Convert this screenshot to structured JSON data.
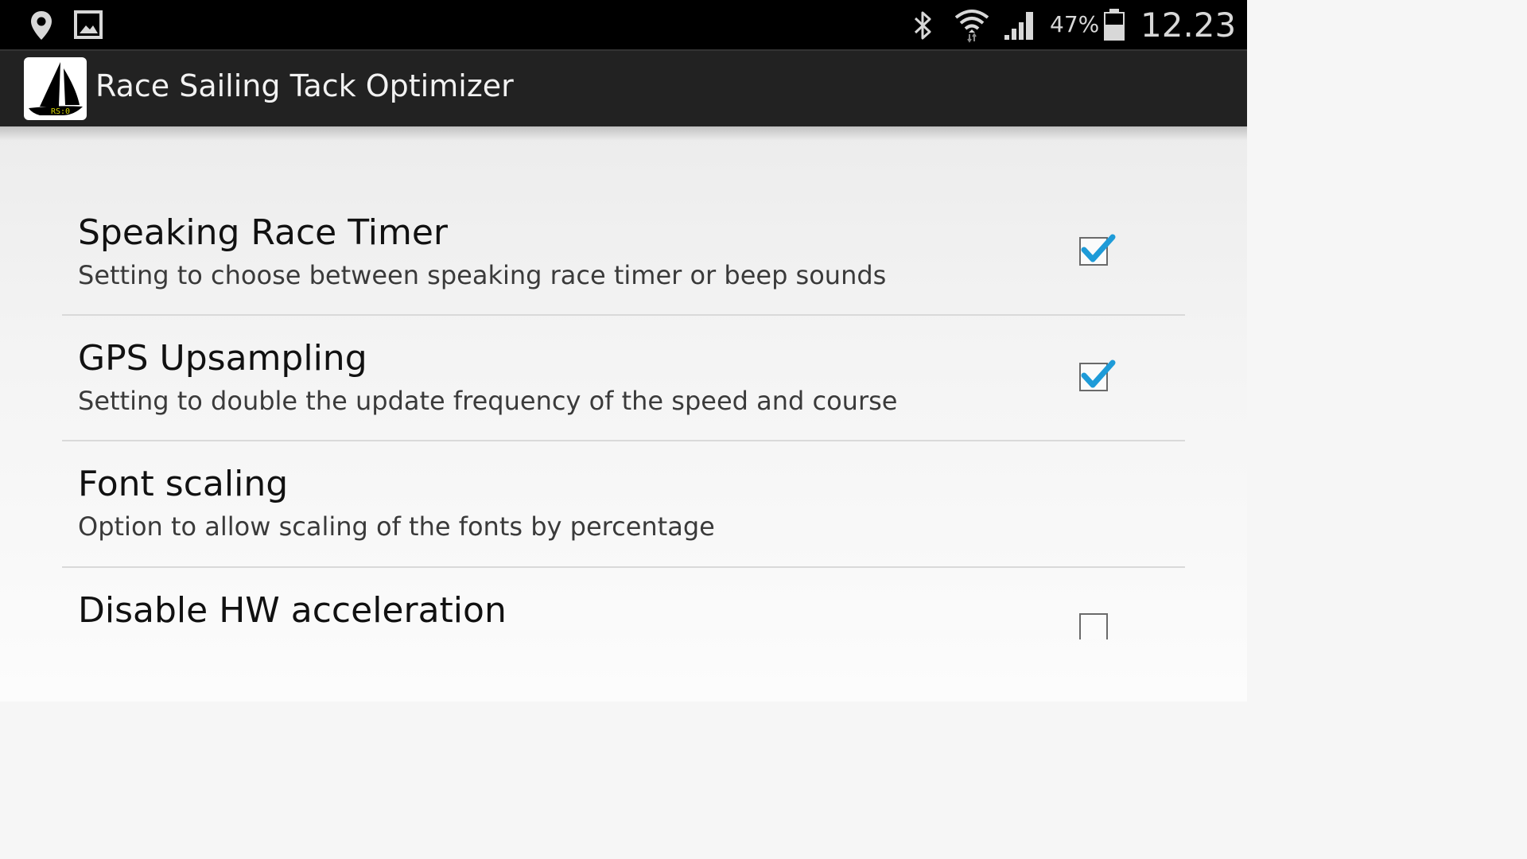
{
  "status_bar": {
    "icons": [
      "location-icon",
      "gallery-icon",
      "bluetooth-icon",
      "wifi-icon",
      "signal-icon",
      "battery-icon"
    ],
    "battery_percent": "47%",
    "time": "12.23"
  },
  "action_bar": {
    "app_icon": "sailboat-app-icon",
    "app_icon_text": "RS:0",
    "title": "Race Sailing Tack Optimizer"
  },
  "preferences": [
    {
      "title": "Speaking Race Timer",
      "summary": "Setting to choose between speaking race timer or beep sounds",
      "checkbox": true,
      "checked": true
    },
    {
      "title": "GPS Upsampling",
      "summary": "Setting to double the update frequency of the speed and course",
      "checkbox": true,
      "checked": true
    },
    {
      "title": "Font scaling",
      "summary": "Option to allow scaling of the fonts by percentage",
      "checkbox": false
    },
    {
      "title": "Disable HW acceleration",
      "summary": "",
      "checkbox": true,
      "checked": false
    }
  ],
  "colors": {
    "status_bar_bg": "#000000",
    "action_bar_bg": "#222222",
    "check_accent": "#1e9bd8"
  }
}
